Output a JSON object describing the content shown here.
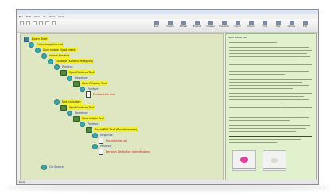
{
  "menubar": [
    "File",
    "Edit",
    "View",
    "Go",
    "Tools",
    "Help"
  ],
  "toolbar": {
    "buttons": [
      "Back",
      "Forward",
      "Refresh",
      "Expand",
      "Collapse",
      "Properties",
      "Import",
      "Export",
      "Print",
      "Help",
      "Options",
      "Exit"
    ]
  },
  "tree": {
    "nodes": [
      {
        "text": "Exam Start",
        "style": "hl",
        "icon": "person"
      },
      {
        "text": "Gram negative rod",
        "style": "hl",
        "icon": "circle"
      },
      {
        "text": "Spot Indole (Spot Ident)",
        "style": "hl",
        "icon": "circle"
      },
      {
        "text": "Indole Positive",
        "style": "hl",
        "icon": "circle"
      },
      {
        "text": "Oxidase (Kovacs' Reagent)",
        "style": "hl",
        "icon": "circle"
      },
      {
        "text": "Positive",
        "style": "blue",
        "icon": "circle"
      },
      {
        "text": "Spot Oxidase Test",
        "style": "hl",
        "icon": "book"
      },
      {
        "text": "Negative",
        "style": "blue",
        "icon": "circle"
      },
      {
        "text": "Spot Oxidase Test",
        "style": "hl",
        "icon": "book"
      },
      {
        "text": "Positive",
        "style": "blue",
        "icon": "circle"
      },
      {
        "text": "Escherichia coli",
        "style": "red",
        "icon": "doc"
      },
      {
        "text": "Not Indicated",
        "style": "hl",
        "icon": "circle"
      },
      {
        "text": "Spot Oxidase Test",
        "style": "hl",
        "icon": "book"
      },
      {
        "text": "Negative",
        "style": "blue",
        "icon": "circle"
      },
      {
        "text": "Spot Indole Test",
        "style": "hl",
        "icon": "book"
      },
      {
        "text": "Positive",
        "style": "blue",
        "icon": "circle"
      },
      {
        "text": "Rapid PYR Test (Pyrrolidonase)",
        "style": "hl",
        "icon": "book"
      },
      {
        "text": "Negative",
        "style": "blue",
        "icon": "circle"
      },
      {
        "text": "Escherichia coli",
        "style": "red",
        "icon": "doc"
      },
      {
        "text": "Positive",
        "style": "blue",
        "icon": "circle"
      },
      {
        "text": "Perform Definitive Identification",
        "style": "red",
        "icon": "doc"
      },
      {
        "text": "Go Search",
        "style": "blue",
        "icon": "circle"
      }
    ]
  },
  "side_panel": {
    "title": "Spot Indole Test"
  },
  "status": "Ready",
  "colors": {
    "tree_bg": "#dfe6c2",
    "panel_bg": "#e2f1cd",
    "highlight": "#f3ee2a",
    "result_red": "#c81b1b",
    "node_teal": "#3aa8a6"
  }
}
